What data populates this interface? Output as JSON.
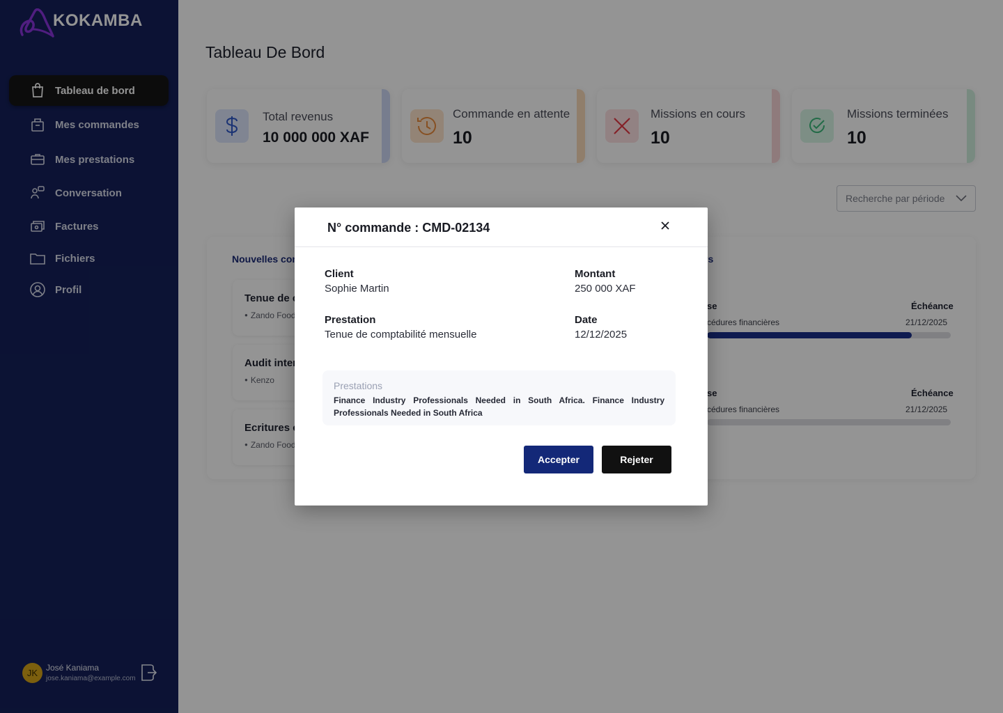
{
  "brand": {
    "name": "KOKAMBA"
  },
  "sidebar": {
    "items": [
      {
        "label": "Tableau de bord",
        "icon": "shopping-bag-icon",
        "active": true
      },
      {
        "label": "Mes commandes",
        "icon": "basket-icon",
        "active": false
      },
      {
        "label": "Mes prestations",
        "icon": "briefcase-icon",
        "active": false
      },
      {
        "label": "Conversation",
        "icon": "chat-icon",
        "active": false
      },
      {
        "label": "Factures",
        "icon": "invoice-icon",
        "active": false
      },
      {
        "label": "Fichiers",
        "icon": "folder-icon",
        "active": false
      },
      {
        "label": "Profil",
        "icon": "user-circle-icon",
        "active": false
      }
    ],
    "user": {
      "initials": "JK",
      "name": "José Kaniama",
      "email": "jose.kaniama@example.com"
    }
  },
  "main": {
    "title": "Tableau De Bord",
    "stats": [
      {
        "label": "Total revenus",
        "value": "10 000 000 XAF",
        "color": "#cdd8f4"
      },
      {
        "label": "Commande en attente",
        "value": "10",
        "color": "#f9d9b9"
      },
      {
        "label": "Missions en cours",
        "value": "10",
        "color": "#f7d4d6"
      },
      {
        "label": "Missions terminées",
        "value": "10",
        "color": "#cfeedd"
      }
    ],
    "period_filter": "Recherche par période",
    "new_orders": {
      "title": "Nouvelles com",
      "items": [
        {
          "title": "Tenue de c",
          "client": "Zando Food"
        },
        {
          "title": "Audit inter",
          "client": "Kenzo"
        },
        {
          "title": "Ecritures c",
          "client": "Zando Food"
        }
      ]
    },
    "missions": {
      "title": "rs",
      "items": [
        {
          "left_label": "se",
          "left_value": "cédures financières",
          "due_label": "Échéance",
          "due": "21/12/2025",
          "progress": 0.84
        },
        {
          "left_label": "se",
          "left_value": "cédures financières",
          "due_label": "Échéance",
          "due": "21/12/2025",
          "progress": 0
        }
      ]
    }
  },
  "modal": {
    "title": "N° commande : CMD-02134",
    "client_label": "Client",
    "client": "Sophie Martin",
    "amount_label": "Montant",
    "amount": "250 000 XAF",
    "service_label": "Prestation",
    "service": "Tenue de comptabilité mensuelle",
    "date_label": "Date",
    "date": "12/12/2025",
    "description_label": "Prestations",
    "description": "Finance Industry Professionals Needed in South Africa. Finance Industry Professionals Needed in South Africa",
    "accept": "Accepter",
    "reject": "Rejeter"
  },
  "colors": {
    "sidebar": "#15205a",
    "accent": "#132878",
    "brand_mark": "#7b2fd1"
  }
}
